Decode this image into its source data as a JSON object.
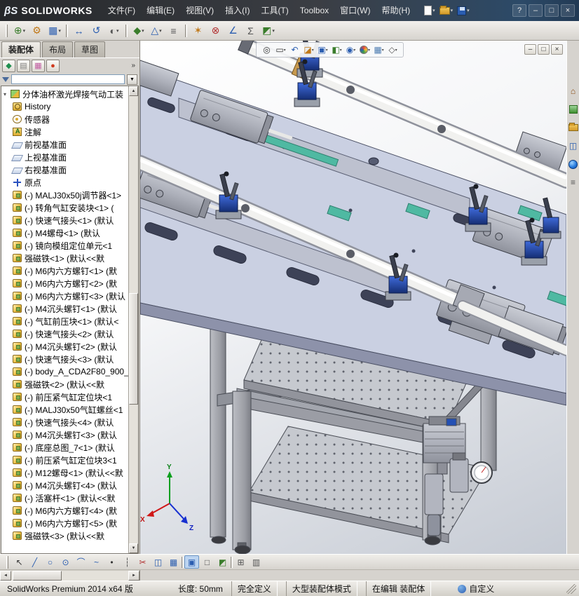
{
  "colors": {
    "chrome": "#d6d3ce",
    "plate": "#cad0e2",
    "plate-edge": "#8d92aa",
    "teal": "#4fb9a2",
    "clamp-blue": "#2450b4",
    "viewport-bottom": "#c6cbd4"
  },
  "titlebar": {
    "logo_mark": "βS",
    "logo_text": "SOLIDWORKS",
    "menus": [
      "文件(F)",
      "编辑(E)",
      "视图(V)",
      "插入(I)",
      "工具(T)",
      "Toolbox",
      "窗口(W)",
      "帮助(H)"
    ],
    "quick_icons": [
      "new-document-icon",
      "open-folder-icon",
      "save-icon"
    ],
    "controls": [
      {
        "name": "help-button",
        "glyph": "?"
      },
      {
        "name": "minimize-button",
        "glyph": "–"
      },
      {
        "name": "maximize-button",
        "glyph": "□"
      },
      {
        "name": "close-button",
        "glyph": "×"
      }
    ]
  },
  "toolbar": {
    "icons": [
      {
        "name": "insert-component-icon",
        "glyph": "⊕",
        "color": "#3a7d2c",
        "arrow": "▾"
      },
      {
        "name": "mate-icon",
        "glyph": "⚙",
        "color": "#c07818"
      },
      {
        "name": "component-pattern-icon",
        "glyph": "▦",
        "color": "#2a5db0",
        "arrow": "▾"
      },
      {
        "name": "toolbar-separator",
        "cls": "sep"
      },
      {
        "name": "move-component-icon",
        "glyph": "↔",
        "color": "#2a5db0"
      },
      {
        "name": "rotate-component-icon",
        "glyph": "↺",
        "color": "#2a5db0"
      },
      {
        "name": "show-hidden-components-icon",
        "glyph": "◐",
        "color": "#555555",
        "arrow": "▾"
      },
      {
        "name": "toolbar-separator",
        "cls": "sep"
      },
      {
        "name": "assembly-features-icon",
        "glyph": "◆",
        "color": "#3a7d2c",
        "arrow": "▾"
      },
      {
        "name": "reference-geometry-icon",
        "glyph": "△",
        "color": "#2a5db0",
        "arrow": "▾"
      },
      {
        "name": "bill-of-materials-icon",
        "glyph": "≡",
        "color": "#555555"
      },
      {
        "name": "toolbar-separator",
        "cls": "sep"
      },
      {
        "name": "exploded-view-icon",
        "glyph": "✶",
        "color": "#c07818"
      },
      {
        "name": "interference-detection-icon",
        "glyph": "⊗",
        "color": "#b03030"
      },
      {
        "name": "measure-icon",
        "glyph": "∠",
        "color": "#2a5db0"
      },
      {
        "name": "mass-properties-icon",
        "glyph": "Σ",
        "color": "#555555"
      },
      {
        "name": "section-view-icon",
        "glyph": "◩",
        "color": "#3a7d2c",
        "arrow": "▾"
      }
    ]
  },
  "tabs": {
    "items": [
      {
        "label": "装配体",
        "cls": "active"
      },
      {
        "label": "布局",
        "cls": ""
      },
      {
        "label": "草图",
        "cls": ""
      }
    ]
  },
  "panel": {
    "tabs": [
      {
        "name": "featuremanager-tab-icon",
        "glyph": "◆",
        "color": "#1f8f4f"
      },
      {
        "name": "propertymanager-tab-icon",
        "glyph": "▤",
        "color": "#808080"
      },
      {
        "name": "configurationmanager-tab-icon",
        "glyph": "▦",
        "color": "#c05aa0"
      },
      {
        "name": "displaymanager-tab-icon",
        "glyph": "●",
        "color": "#d03a1e"
      }
    ],
    "overflow": "»",
    "filter_arrow": "▼"
  },
  "tree": {
    "root": "分体油杯激光焊接气动工装",
    "expander": "▾",
    "scroll_up": "▲",
    "scroll_down": "▼",
    "items": [
      {
        "icon": "icon-history",
        "label": "History"
      },
      {
        "icon": "icon-sensors",
        "label": "传感器"
      },
      {
        "icon": "icon-annotations",
        "label": "注解"
      },
      {
        "icon": "icon-plane",
        "label": "前视基准面"
      },
      {
        "icon": "icon-plane",
        "label": "上视基准面"
      },
      {
        "icon": "icon-plane",
        "label": "右视基准面"
      },
      {
        "icon": "icon-origin",
        "label": "原点"
      },
      {
        "icon": "icon-part",
        "label": "(-) MALJ30x50j调节器<1>"
      },
      {
        "icon": "icon-part",
        "label": "(-) 转角气缸安装块<1> ("
      },
      {
        "icon": "icon-part",
        "label": "(-) 快速气接头<1> (默认"
      },
      {
        "icon": "icon-part",
        "label": "(-) M4螺母<1> (默认"
      },
      {
        "icon": "icon-part",
        "label": "(-) 镜向模组定位单元<1"
      },
      {
        "icon": "icon-part",
        "label": "强磁铁<1> (默认<<默"
      },
      {
        "icon": "icon-part",
        "label": "(-) M6内六方螺钉<1> (默"
      },
      {
        "icon": "icon-part",
        "label": "(-) M6内六方螺钉<2> (默"
      },
      {
        "icon": "icon-part",
        "label": "(-) M6内六方螺钉<3> (默认"
      },
      {
        "icon": "icon-part",
        "label": "(-) M4沉头螺钉<1> (默认"
      },
      {
        "icon": "icon-part",
        "label": "(-) 气缸前压块<1> (默认<"
      },
      {
        "icon": "icon-part",
        "label": "(-) 快速气接头<2> (默认"
      },
      {
        "icon": "icon-part",
        "label": "(-) M4沉头螺钉<2> (默认"
      },
      {
        "icon": "icon-part",
        "label": "(-) 快速气接头<3> (默认"
      },
      {
        "icon": "icon-part",
        "label": "(-) body_A_CDA2F80_900_"
      },
      {
        "icon": "icon-part",
        "label": "强磁铁<2> (默认<<默"
      },
      {
        "icon": "icon-part",
        "label": "(-) 前压紧气缸定位块<1"
      },
      {
        "icon": "icon-part",
        "label": "(-) MALJ30x50气缸螺丝<1"
      },
      {
        "icon": "icon-part",
        "label": "(-) 快速气接头<4> (默认"
      },
      {
        "icon": "icon-part",
        "label": "(-) M4沉头螺钉<3> (默认"
      },
      {
        "icon": "icon-part",
        "label": "(-) 底座总图_7<1> (默认"
      },
      {
        "icon": "icon-part",
        "label": "(-) 前压紧气缸定位块3<1"
      },
      {
        "icon": "icon-part",
        "label": "(-) M12螺母<1> (默认<<默"
      },
      {
        "icon": "icon-part",
        "label": "(-) M4沉头螺钉<4> (默认"
      },
      {
        "icon": "icon-part",
        "label": "(-) 活塞杆<1> (默认<<默"
      },
      {
        "icon": "icon-part",
        "label": "(-) M6内六方螺钉<4> (默"
      },
      {
        "icon": "icon-part",
        "label": "(-) M6内六方螺钉<5> (默"
      },
      {
        "icon": "icon-part",
        "label": "强磁铁<3> (默认<<默"
      }
    ]
  },
  "hud": {
    "icons": [
      {
        "name": "zoom-fit-icon",
        "glyph": "◎",
        "color": "#333333"
      },
      {
        "name": "zoom-area-icon",
        "glyph": "▭",
        "color": "#333333",
        "arrow": "▾"
      },
      {
        "name": "previous-view-icon",
        "glyph": "↶",
        "color": "#2a5db0"
      },
      {
        "name": "section-view-icon",
        "glyph": "◪",
        "color": "#c07818",
        "arrow": "▾"
      },
      {
        "name": "view-orientation-icon",
        "glyph": "▣",
        "color": "#2a5db0",
        "arrow": "▾"
      },
      {
        "name": "display-style-icon",
        "glyph": "◧",
        "color": "#3a7d2c",
        "arrow": "▾"
      },
      {
        "name": "hide-show-items-icon",
        "glyph": "◉",
        "color": "#2a5db0",
        "arrow": "▾"
      },
      {
        "name": "edit-appearance-icon",
        "cls": "ball2",
        "arrow": "▾"
      },
      {
        "name": "apply-scene-icon",
        "glyph": "▦",
        "color": "#4a7ab0",
        "arrow": "▾"
      },
      {
        "name": "view-settings-icon",
        "glyph": "◇",
        "color": "#555555",
        "arrow": "▾"
      }
    ]
  },
  "docbar": {
    "controls": [
      {
        "name": "minimize-document-icon",
        "glyph": "–"
      },
      {
        "name": "restore-document-icon",
        "glyph": "□"
      },
      {
        "name": "close-document-icon",
        "glyph": "×"
      }
    ]
  },
  "taskpane": {
    "icons": [
      {
        "name": "solidworks-resources-icon",
        "glyph": "⌂",
        "color": "#8a4a10"
      },
      {
        "name": "design-library-icon",
        "cls": "lib"
      },
      {
        "name": "file-explorer-icon",
        "cls": "folder"
      },
      {
        "name": "view-palette-icon",
        "glyph": "◫",
        "color": "#2a5db0"
      },
      {
        "name": "appearances-icon",
        "cls": "ball"
      },
      {
        "name": "custom-properties-icon",
        "glyph": "≡",
        "color": "#555555"
      }
    ]
  },
  "sketchbar": {
    "icons": [
      {
        "name": "select-tool-icon",
        "glyph": "↖",
        "color": "#333333"
      },
      {
        "name": "line-tool-icon",
        "glyph": "╱",
        "color": "#2a5db0"
      },
      {
        "name": "circle-tool-icon",
        "glyph": "○",
        "color": "#2a5db0"
      },
      {
        "name": "ellipse-tool-icon",
        "glyph": "⊙",
        "color": "#2a5db0"
      },
      {
        "name": "arc-tool-icon",
        "glyph": "⌒",
        "color": "#2a5db0"
      },
      {
        "name": "spline-tool-icon",
        "glyph": "~",
        "color": "#2a5db0"
      },
      {
        "name": "point-tool-icon",
        "glyph": "•",
        "color": "#333333"
      },
      {
        "name": "centerline-tool-icon",
        "glyph": "┆",
        "color": "#555555"
      },
      {
        "name": "trim-tool-icon",
        "glyph": "✂",
        "color": "#b03030"
      },
      {
        "name": "mirror-tool-icon",
        "glyph": "◫",
        "color": "#2a5db0"
      },
      {
        "name": "linear-pattern-tool-icon",
        "glyph": "▦",
        "color": "#2a5db0"
      },
      {
        "name": "sketchbar-separator",
        "cls": "sep"
      },
      {
        "name": "shaded-view-icon",
        "glyph": "▣",
        "color": "#2a5db0",
        "cls": "active"
      },
      {
        "name": "wireframe-view-icon",
        "glyph": "□",
        "color": "#555555"
      },
      {
        "name": "section-display-icon",
        "glyph": "◩",
        "color": "#3a7d2c"
      },
      {
        "name": "sketchbar-separator",
        "cls": "sep"
      },
      {
        "name": "grid-icon",
        "glyph": "⊞",
        "color": "#555555"
      },
      {
        "name": "table-icon",
        "glyph": "▥",
        "color": "#555555"
      }
    ]
  },
  "scrollbars": {
    "left": "◄",
    "right": "►"
  },
  "statusbar": {
    "product": "SolidWorks Premium 2014 x64 版",
    "measure": "长度: 50mm",
    "define_state": "完全定义",
    "mode": "大型装配体模式",
    "editing": "在编辑 装配体",
    "custom": "自定义"
  }
}
